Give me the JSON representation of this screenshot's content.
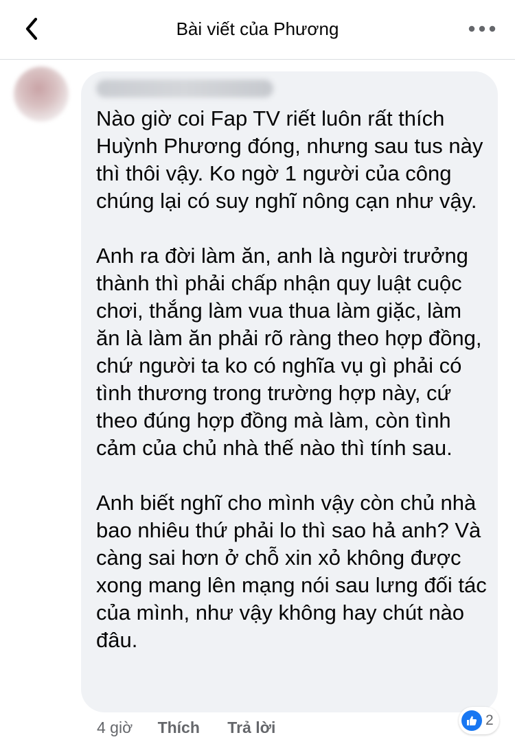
{
  "header": {
    "title": "Bài viết của Phương",
    "back_icon": "chevron-left-icon",
    "more_icon": "more-horizontal-icon"
  },
  "comment": {
    "paragraphs": [
      "Nào giờ coi Fap TV riết luôn rất thích Huỳnh Phương đóng, nhưng sau tus này thì thôi vậy. Ko ngờ 1 người của công chúng lại có suy nghĩ nông cạn như vậy.",
      "Anh ra đời làm ăn, anh là người trưởng thành thì phải chấp nhận quy luật cuộc chơi, thắng làm vua thua làm giặc, làm ăn là làm ăn phải rõ ràng theo hợp đồng, chứ người ta ko có nghĩa vụ gì phải có tình thương trong trường hợp này, cứ theo đúng hợp đồng mà làm, còn tình cảm của chủ nhà thế nào thì tính sau.",
      "Anh biết nghĩ cho mình vậy còn chủ nhà bao nhiêu thứ phải lo thì sao hả anh? Và càng sai hơn ở chỗ xin xỏ không được xong mang lên mạng nói sau lưng đối tác của mình, như vậy không hay chút nào đâu."
    ],
    "time": "4 giờ",
    "like_label": "Thích",
    "reply_label": "Trả lời",
    "reaction_icon": "like-icon",
    "reaction_count": "2",
    "accent_color": "#1877f2"
  }
}
